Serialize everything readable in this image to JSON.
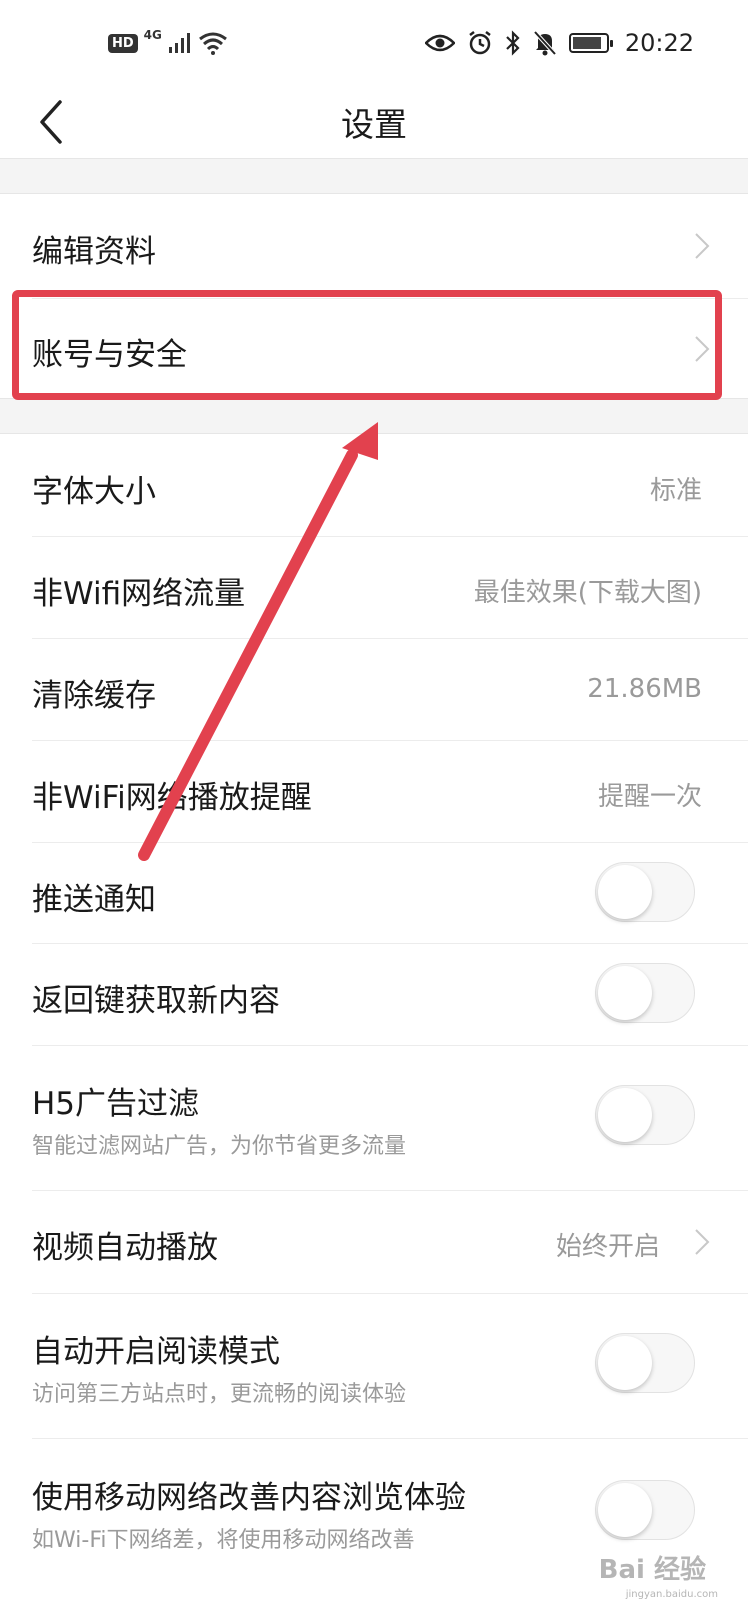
{
  "status_bar": {
    "hd": "HD",
    "network": "4G",
    "time": "20:22",
    "icons": [
      "signal-icon",
      "wifi-icon",
      "eye-icon",
      "alarm-icon",
      "bluetooth-icon",
      "mute-bell-icon",
      "battery-icon"
    ]
  },
  "header": {
    "title": "设置",
    "back_icon": "chevron-left-icon"
  },
  "sections": [
    {
      "items": [
        {
          "label": "编辑资料",
          "type": "link"
        },
        {
          "label": "账号与安全",
          "type": "link"
        }
      ]
    },
    {
      "items": [
        {
          "label": "字体大小",
          "type": "value",
          "value": "标准"
        },
        {
          "label": "非Wifi网络流量",
          "type": "value",
          "value": "最佳效果(下载大图)"
        },
        {
          "label": "清除缓存",
          "type": "value",
          "value": "21.86MB"
        },
        {
          "label": "非WiFi网络播放提醒",
          "type": "value",
          "value": "提醒一次"
        },
        {
          "label": "推送通知",
          "type": "toggle",
          "on": false
        },
        {
          "label": "返回键获取新内容",
          "type": "toggle",
          "on": false
        },
        {
          "label": "H5广告过滤",
          "subtitle": "智能过滤网站广告，为你节省更多流量",
          "type": "toggle",
          "on": false
        },
        {
          "label": "视频自动播放",
          "type": "value-link",
          "value": "始终开启"
        },
        {
          "label": "自动开启阅读模式",
          "subtitle": "访问第三方站点时，更流畅的阅读体验",
          "type": "toggle",
          "on": false
        },
        {
          "label": "使用移动网络改善内容浏览体验",
          "subtitle": "如Wi-Fi下网络差，将使用移动网络改善",
          "type": "toggle",
          "on": false
        }
      ]
    }
  ],
  "annotation": {
    "highlight_color": "#e2414e",
    "target": "账号与安全"
  },
  "watermark": {
    "text": "Bai 经验",
    "sub": "jingyan.baidu.com"
  },
  "colors": {
    "text_primary": "#1a1a1a",
    "text_secondary": "#9a9a9a",
    "section_gap": "#f4f4f4"
  }
}
